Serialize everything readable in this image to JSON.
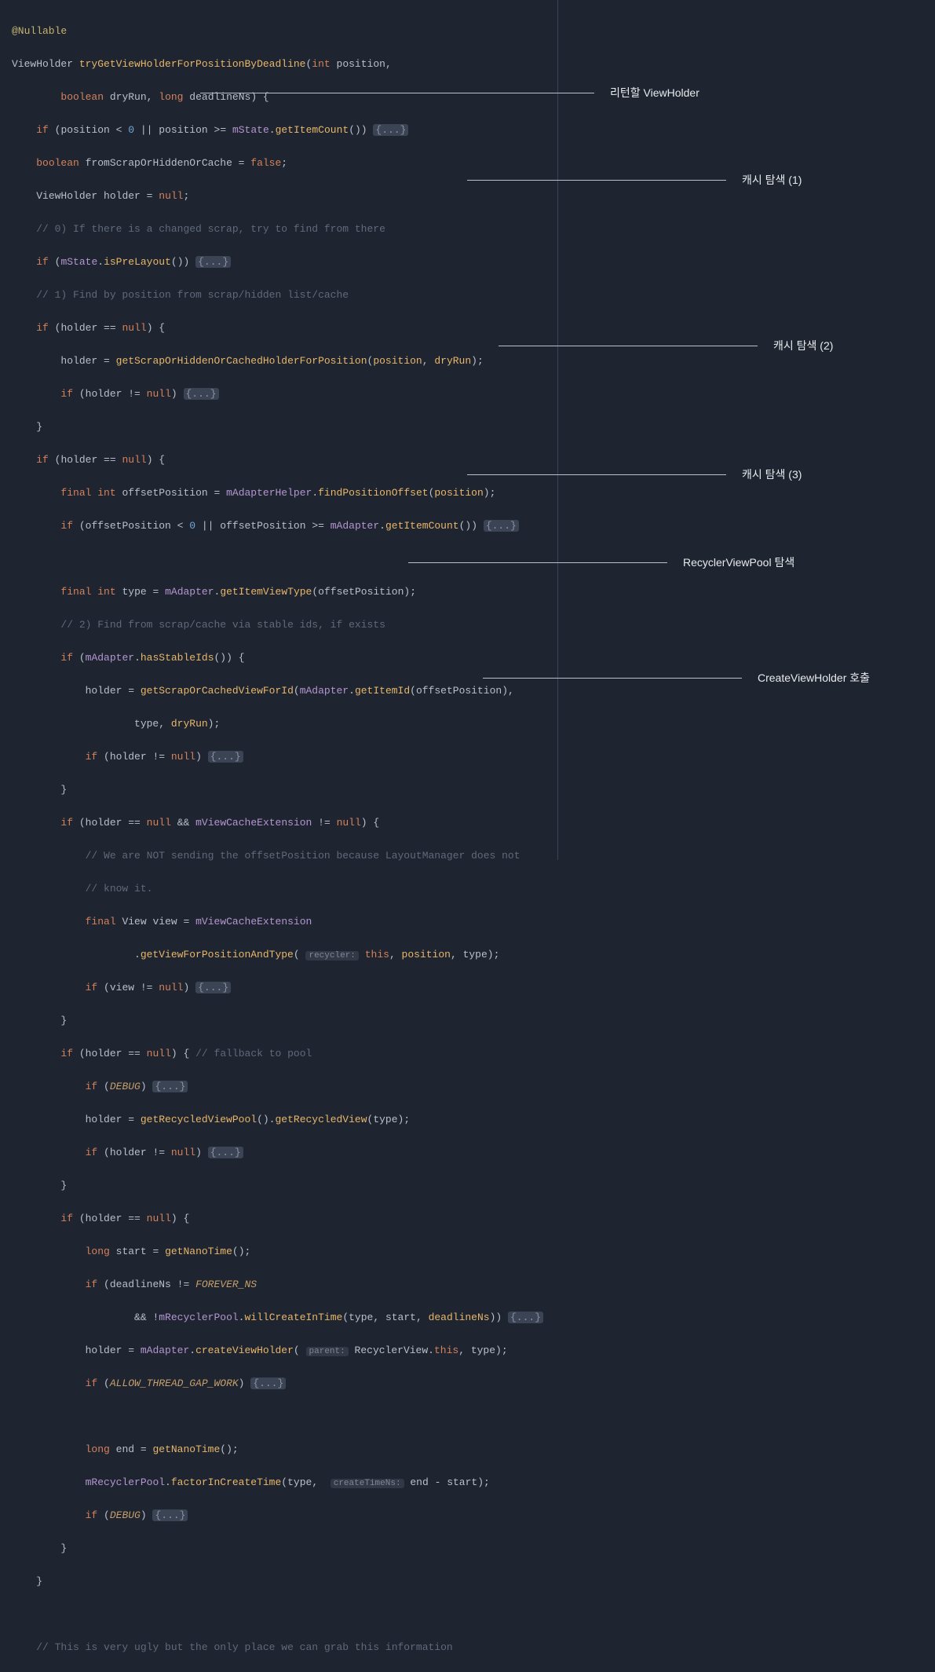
{
  "annotations": {
    "a1": "리턴할 ViewHolder",
    "a2": "캐시 탐색 (1)",
    "a3": "캐시 탐색 (2)",
    "a4": "캐시 탐색 (3)",
    "a5": "RecyclerViewPool 탐색",
    "a6": "CreateViewHolder 호출"
  },
  "code": {
    "t_nullable": "@Nullable",
    "t_viewholder": "ViewHolder",
    "t_fn": "tryGetViewHolderForPositionByDeadline",
    "t_int": "int",
    "t_position": "position",
    "t_boolean": "boolean",
    "t_dryrun": "dryRun",
    "t_long": "long",
    "t_deadlinens": "deadlineNs",
    "t_if": "if",
    "t_zero": "0",
    "t_mstate": "mState",
    "t_getitemcount": "getItemCount",
    "t_fold": "{...}",
    "t_fromscrap": "fromScrapOrHiddenOrCache",
    "t_false": "false",
    "t_holder": "holder",
    "t_null": "null",
    "c0": "// 0) If there is a changed scrap, try to find from there",
    "t_isprelayout": "isPreLayout",
    "c1": "// 1) Find by position from scrap/hidden list/cache",
    "t_getscraphidden": "getScrapOrHiddenOrCachedHolderForPosition",
    "t_final": "final",
    "t_offsetpos": "offsetPosition",
    "t_madapterhelper": "mAdapterHelper",
    "t_findposoffset": "findPositionOffset",
    "t_madapter": "mAdapter",
    "t_type": "type",
    "t_getitemviewtype": "getItemViewType",
    "c2": "// 2) Find from scrap/cache via stable ids, if exists",
    "t_hasstableids": "hasStableIds",
    "t_getscrapid": "getScrapOrCachedViewForId",
    "t_getitemid": "getItemId",
    "t_andand": "&&",
    "t_mviewcacheext": "mViewCacheExtension",
    "c_not1": "// We are NOT sending the offsetPosition because LayoutManager does not",
    "c_not2": "// know it.",
    "t_view_type": "View",
    "t_view": "view",
    "t_getviewforpos": "getViewForPositionAndType",
    "h_recycler": "recycler:",
    "t_this": "this",
    "c_fallback": "// fallback to pool",
    "t_debug": "DEBUG",
    "t_getrecycledpool": "getRecycledViewPool",
    "t_getrecycledview": "getRecycledView",
    "t_start": "start",
    "t_getnanotime": "getNanoTime",
    "t_foreverns": "FOREVER_NS",
    "t_mrecyclerpool": "mRecyclerPool",
    "t_willcreate": "willCreateInTime",
    "t_createvh": "createViewHolder",
    "h_parent": "parent:",
    "t_recyclerview": "RecyclerView",
    "t_allowthread": "ALLOW_THREAD_GAP_WORK",
    "t_end": "end",
    "t_factorin": "factorInCreateTime",
    "h_createtimens": "createTimeNs:",
    "c_ugly": "// This is very ugly but the only place we can grab this information"
  }
}
